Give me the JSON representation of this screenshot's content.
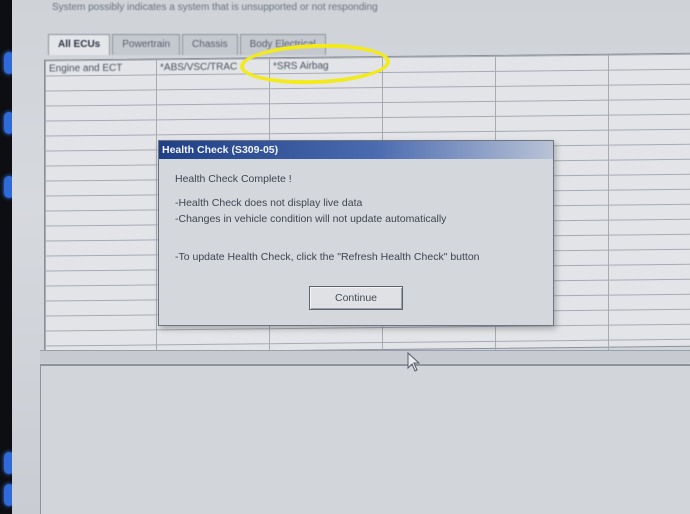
{
  "app": {
    "banner": "System possibly indicates a system that is unsupported or not responding"
  },
  "tabs": [
    {
      "label": "All ECUs",
      "active": true
    },
    {
      "label": "Powertrain",
      "active": false
    },
    {
      "label": "Chassis",
      "active": false
    },
    {
      "label": "Body Electrical",
      "active": false
    }
  ],
  "systems_grid": {
    "columns": [
      "Engine and ECT",
      "*ABS/VSC/TRAC",
      "*SRS Airbag",
      "",
      "",
      ""
    ],
    "rows": 19
  },
  "dialog": {
    "title": "Health Check (S309-05)",
    "lines": [
      "Health Check Complete !",
      "-Health Check does not display live data",
      "-Changes in vehicle condition will not update automatically",
      "-To update Health Check, click the \"Refresh Health Check\" button"
    ],
    "continue_label": "Continue"
  },
  "annotation": {
    "color": "#f2ea1c"
  },
  "colors": {
    "titlebar": "#1f3f86",
    "side_indicator": "#2f6ad9"
  }
}
